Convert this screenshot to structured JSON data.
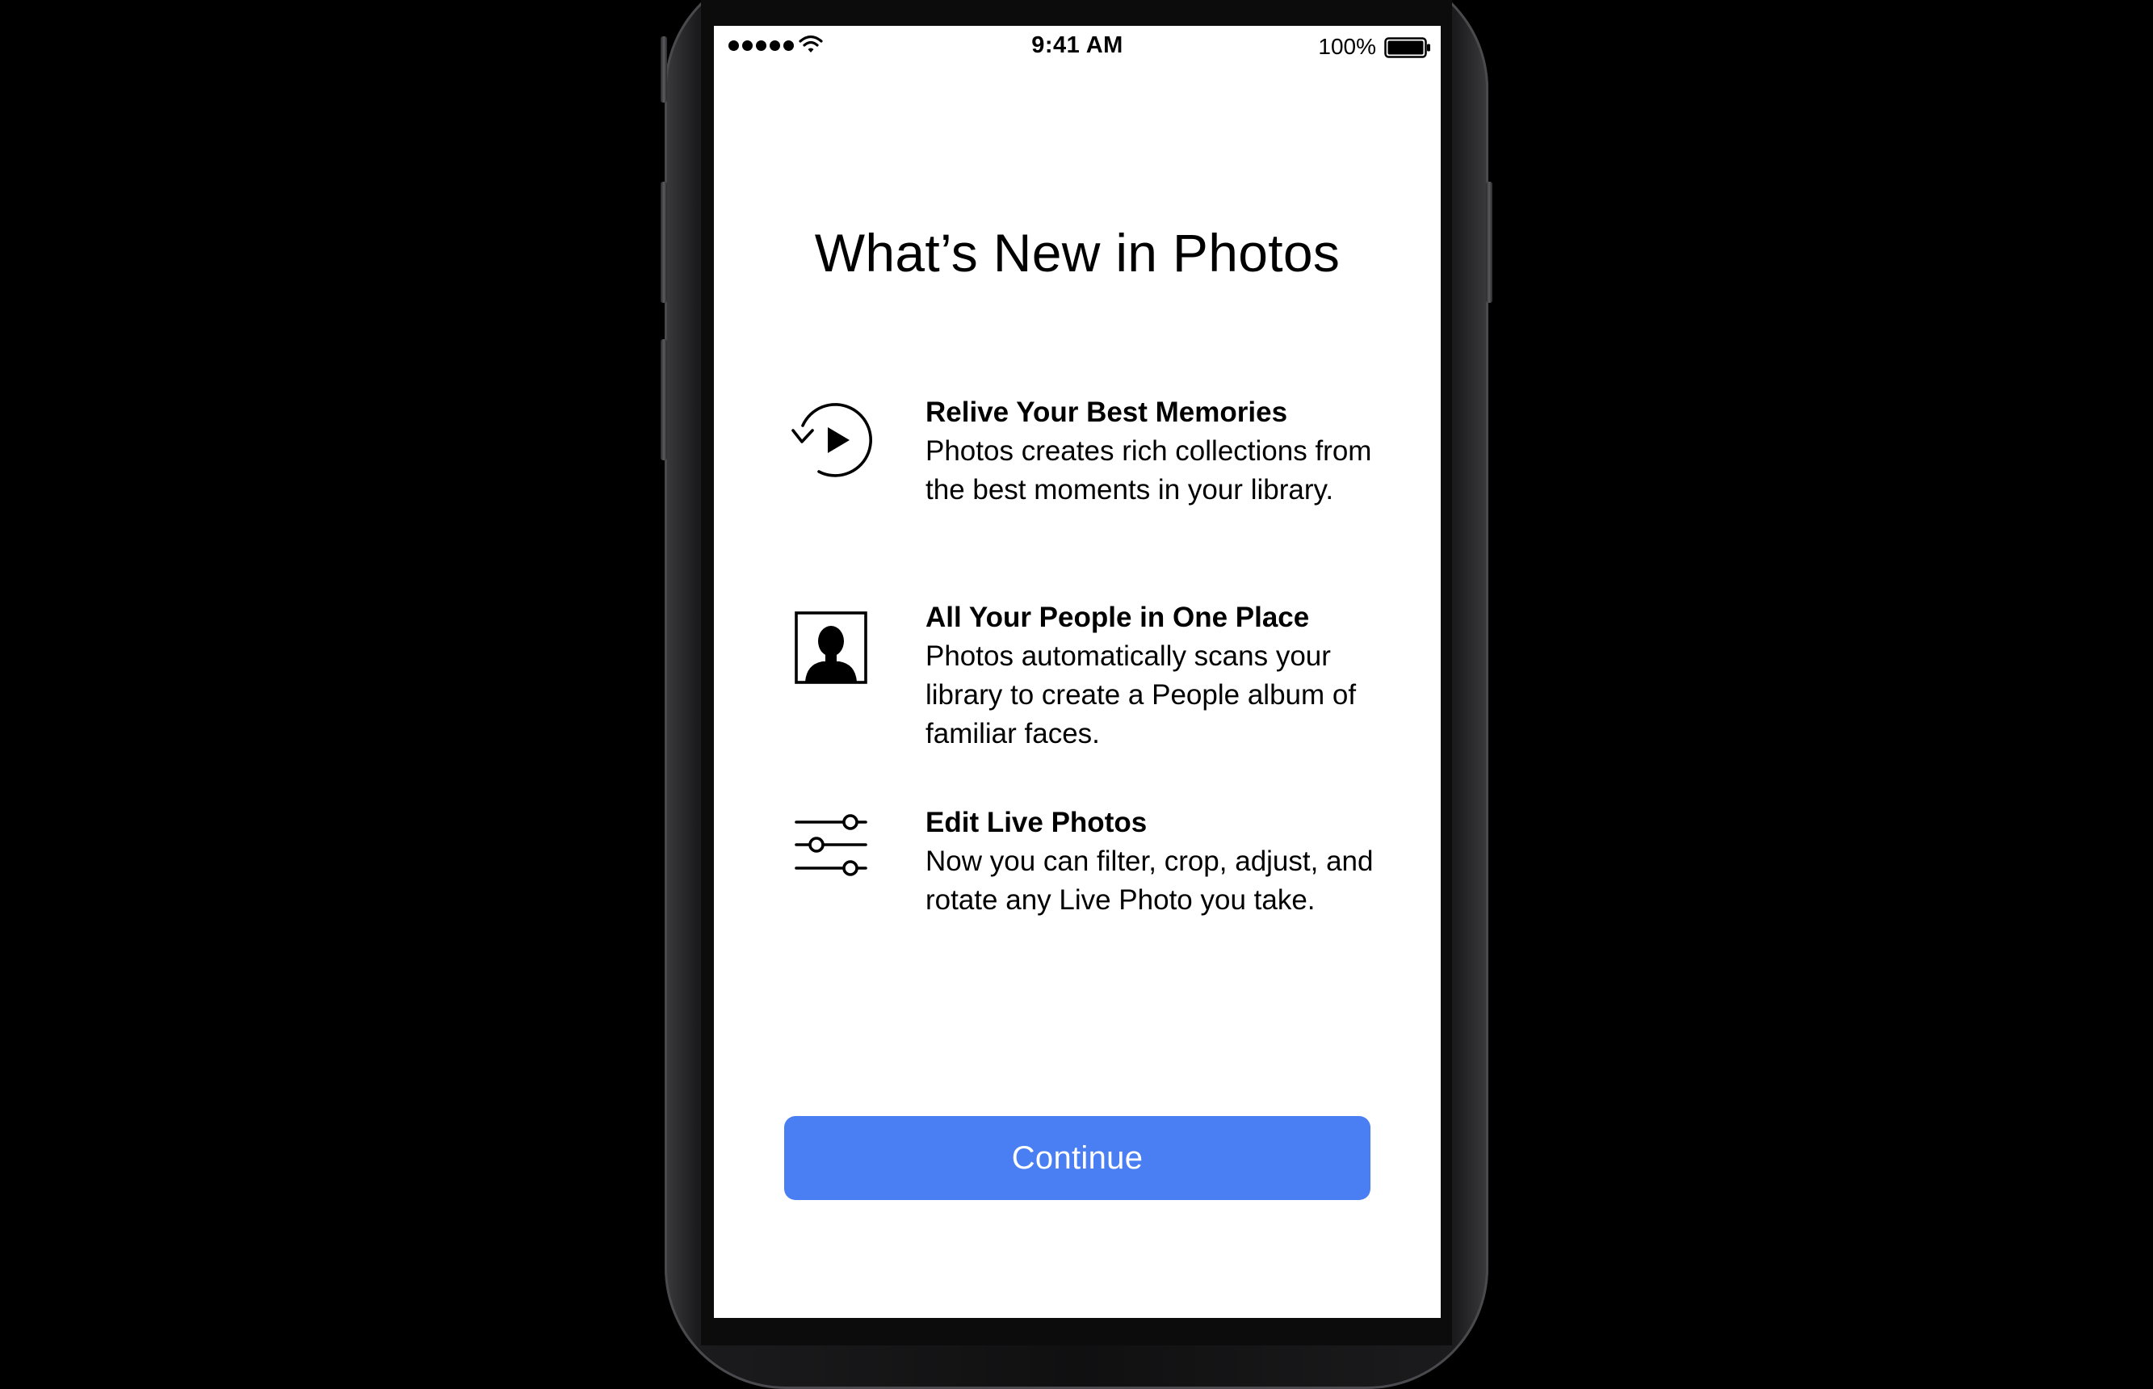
{
  "status_bar": {
    "time": "9:41 AM",
    "battery_percent": "100%",
    "signal_icon": "signal-dots-icon",
    "wifi_icon": "wifi-icon",
    "battery_icon": "battery-icon"
  },
  "onboarding": {
    "title": "What’s New in Photos",
    "features": [
      {
        "icon": "memories-replay-icon",
        "heading": "Relive Your Best Memories",
        "body": "Photos creates rich collections from the best moments in your library."
      },
      {
        "icon": "people-portrait-icon",
        "heading": "All Your People in One Place",
        "body": "Photos automatically scans your library to create a People album of familiar faces."
      },
      {
        "icon": "adjust-sliders-icon",
        "heading": "Edit Live Photos",
        "body": "Now you can filter, crop, adjust, and rotate any Live Photo you take."
      }
    ],
    "continue_label": "Continue"
  },
  "colors": {
    "accent_button": "#4a7ff4",
    "screen_background": "#ffffff",
    "frame": "#000000"
  }
}
